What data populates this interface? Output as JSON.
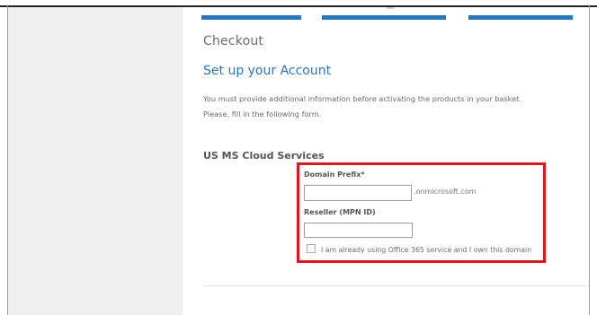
{
  "checkout": {
    "title": "Checkout",
    "heading": "Set up your Account",
    "info_lines": [
      "You must provide additional information before activating the products in your basket.",
      "Please, fill in the following form."
    ]
  },
  "section": {
    "title": "US MS Cloud Services"
  },
  "form": {
    "domain_label": "Domain Prefix*",
    "domain_value": "",
    "domain_suffix": ".onmicrosoft.com",
    "reseller_label": "Reseller (MPN ID)",
    "reseller_value": "",
    "existing_domain_label": "I am already using Office 365 service and I own this domain",
    "existing_domain_checked": false
  },
  "colors": {
    "accent": "#2a76bd",
    "highlight_box": "#d71920",
    "sidebar": "#efefef"
  }
}
